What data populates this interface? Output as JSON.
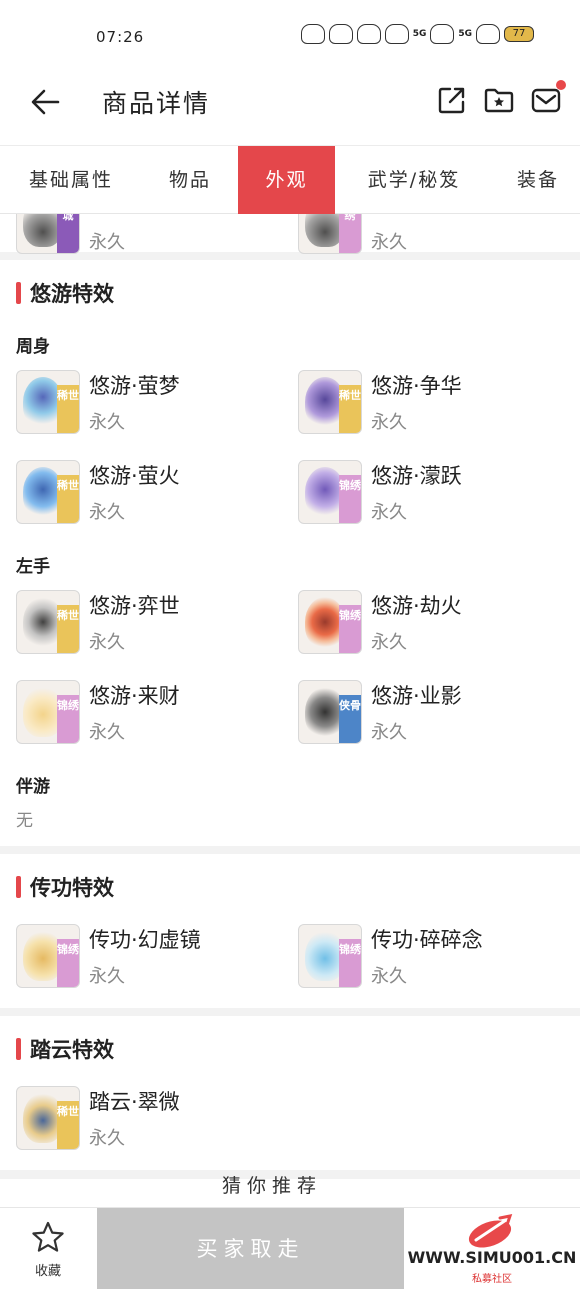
{
  "status_bar": {
    "time": "07:26",
    "signal_5g_1": "5G",
    "signal_5g_2": "5G",
    "battery": "77"
  },
  "header": {
    "title": "商品详情"
  },
  "tabs": [
    {
      "label": "基础属性"
    },
    {
      "label": "物品"
    },
    {
      "label": "外观"
    },
    {
      "label": "武学/秘笈"
    },
    {
      "label": "装备"
    }
  ],
  "active_tab": "外观",
  "top_partial": {
    "left": {
      "tag": "城",
      "duration": "永久"
    },
    "right": {
      "tag": "绣",
      "duration": "永久"
    }
  },
  "sections": {
    "youyou": {
      "title": "悠游特效",
      "zhoushen": {
        "label": "周身",
        "items": [
          {
            "name": "悠游·萤梦",
            "duration": "永久",
            "tag": "稀世"
          },
          {
            "name": "悠游·争华",
            "duration": "永久",
            "tag": "稀世"
          },
          {
            "name": "悠游·萤火",
            "duration": "永久",
            "tag": "稀世"
          },
          {
            "name": "悠游·濛跃",
            "duration": "永久",
            "tag": "锦绣"
          }
        ]
      },
      "zuoshou": {
        "label": "左手",
        "items": [
          {
            "name": "悠游·弈世",
            "duration": "永久",
            "tag": "稀世"
          },
          {
            "name": "悠游·劫火",
            "duration": "永久",
            "tag": "锦绣"
          },
          {
            "name": "悠游·来财",
            "duration": "永久",
            "tag": "锦绣"
          },
          {
            "name": "悠游·业影",
            "duration": "永久",
            "tag": "侠骨"
          }
        ]
      },
      "banyou": {
        "label": "伴游",
        "value": "无"
      }
    },
    "chuangong": {
      "title": "传功特效",
      "items": [
        {
          "name": "传功·幻虚镜",
          "duration": "永久",
          "tag": "锦绣"
        },
        {
          "name": "传功·碎碎念",
          "duration": "永久",
          "tag": "锦绣"
        }
      ]
    },
    "tayun": {
      "title": "踏云特效",
      "items": [
        {
          "name": "踏云·翠微",
          "duration": "永久",
          "tag": "稀世"
        }
      ]
    }
  },
  "recommend": {
    "label": "猜你推荐"
  },
  "bottom_bar": {
    "favorite_label": "收藏",
    "buy_label": "买家取走",
    "watermark_url": "WWW.SIMU001.CN",
    "watermark_cn": "私募社区"
  },
  "colors": {
    "accent": "#e4474b",
    "gold_tag": "#eac45a",
    "pink_tag": "#d99bd3",
    "blue_tag": "#4d85c8"
  }
}
